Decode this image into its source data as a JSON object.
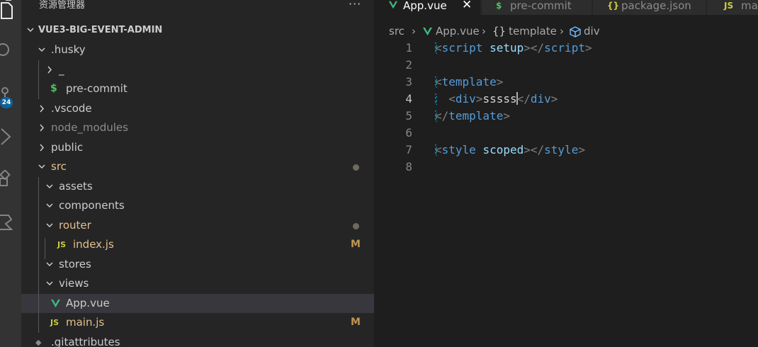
{
  "explorer": {
    "title": "资源管理器",
    "more": "···",
    "root": "VUE3-BIG-EVENT-ADMIN"
  },
  "activity": {
    "badge": "24"
  },
  "tree": [
    {
      "label": ".husky",
      "type": "folder-open",
      "depth": 1,
      "color": "#cccccc"
    },
    {
      "label": "_",
      "type": "folder-closed",
      "depth": 2,
      "color": "#cccccc"
    },
    {
      "label": "pre-commit",
      "type": "file",
      "icon": "$",
      "icon_color": "#4fc15e",
      "depth": 2,
      "color": "#cccccc"
    },
    {
      "label": ".vscode",
      "type": "folder-closed",
      "depth": 1,
      "color": "#cccccc"
    },
    {
      "label": "node_modules",
      "type": "folder-closed",
      "depth": 1,
      "color": "#8c8c8c"
    },
    {
      "label": "public",
      "type": "folder-closed",
      "depth": 1,
      "color": "#cccccc"
    },
    {
      "label": "src",
      "type": "folder-open",
      "depth": 1,
      "color": "#e2c08d",
      "dot": true
    },
    {
      "label": "assets",
      "type": "folder-open",
      "depth": 2,
      "color": "#cccccc"
    },
    {
      "label": "components",
      "type": "folder-open",
      "depth": 2,
      "color": "#cccccc"
    },
    {
      "label": "router",
      "type": "folder-open",
      "depth": 2,
      "color": "#e2c08d",
      "dot": true
    },
    {
      "label": "index.js",
      "type": "file",
      "icon": "JS",
      "icon_color": "#cbcb41",
      "depth": 3,
      "color": "#e2c08d",
      "deco": "M"
    },
    {
      "label": "stores",
      "type": "folder-open",
      "depth": 2,
      "color": "#cccccc"
    },
    {
      "label": "views",
      "type": "folder-open",
      "depth": 2,
      "color": "#cccccc"
    },
    {
      "label": "App.vue",
      "type": "file",
      "icon": "vue",
      "icon_color": "#41b883",
      "depth": 2,
      "color": "#cccccc",
      "selected": true
    },
    {
      "label": "main.js",
      "type": "file",
      "icon": "JS",
      "icon_color": "#cbcb41",
      "depth": 2,
      "color": "#e2c08d",
      "deco": "M"
    },
    {
      "label": ".gitattributes",
      "type": "file",
      "icon": "git",
      "icon_color": "#8c8c8c",
      "depth": 1,
      "color": "#cccccc"
    }
  ],
  "tabs": [
    {
      "label": "App.vue",
      "icon": "vue",
      "icon_color": "#41b883",
      "active": true,
      "close": "✕"
    },
    {
      "label": "pre-commit",
      "icon": "$",
      "icon_color": "#4fc15e"
    },
    {
      "label": "package.json",
      "icon": "{}",
      "icon_color": "#cbcb41"
    },
    {
      "label": "main.js",
      "icon": "JS",
      "icon_color": "#cbcb41"
    }
  ],
  "breadcrumb": [
    {
      "text": "src"
    },
    {
      "text": "›",
      "sep": true
    },
    {
      "text": "App.vue",
      "icon": "vue",
      "icon_color": "#41b883"
    },
    {
      "text": "›",
      "sep": true
    },
    {
      "text": "template",
      "icon": "{}",
      "icon_color": "#cccccc"
    },
    {
      "text": "›",
      "sep": true
    },
    {
      "text": "div",
      "icon": "cube",
      "icon_color": "#75beff"
    }
  ],
  "editor": {
    "active_line": 4,
    "lines": [
      {
        "n": "1",
        "gutter": true,
        "tokens": [
          [
            "p",
            "<"
          ],
          [
            "t",
            "script"
          ],
          [
            "x",
            " "
          ],
          [
            "a",
            "setup"
          ],
          [
            "p",
            ">"
          ],
          [
            "p",
            "</"
          ],
          [
            "t",
            "script"
          ],
          [
            "p",
            ">"
          ]
        ]
      },
      {
        "n": "2",
        "tokens": []
      },
      {
        "n": "3",
        "gutter": true,
        "tokens": [
          [
            "p",
            "<"
          ],
          [
            "t",
            "template"
          ],
          [
            "p",
            ">"
          ]
        ]
      },
      {
        "n": "4",
        "gutter": true,
        "tokens": [
          [
            "x",
            "  "
          ],
          [
            "p",
            "<"
          ],
          [
            "t",
            "div"
          ],
          [
            "p",
            ">"
          ],
          [
            "x",
            "sssss"
          ],
          [
            "cursor",
            ""
          ],
          [
            "p",
            "</"
          ],
          [
            "t",
            "div"
          ],
          [
            "p",
            ">"
          ]
        ]
      },
      {
        "n": "5",
        "gutter": true,
        "tokens": [
          [
            "p",
            "</"
          ],
          [
            "t",
            "template"
          ],
          [
            "p",
            ">"
          ]
        ]
      },
      {
        "n": "6",
        "tokens": []
      },
      {
        "n": "7",
        "gutter": true,
        "tokens": [
          [
            "p",
            "<"
          ],
          [
            "t",
            "style"
          ],
          [
            "x",
            " "
          ],
          [
            "a",
            "scoped"
          ],
          [
            "p",
            ">"
          ],
          [
            "p",
            "</"
          ],
          [
            "t",
            "style"
          ],
          [
            "p",
            ">"
          ]
        ]
      },
      {
        "n": "8",
        "tokens": []
      }
    ]
  }
}
